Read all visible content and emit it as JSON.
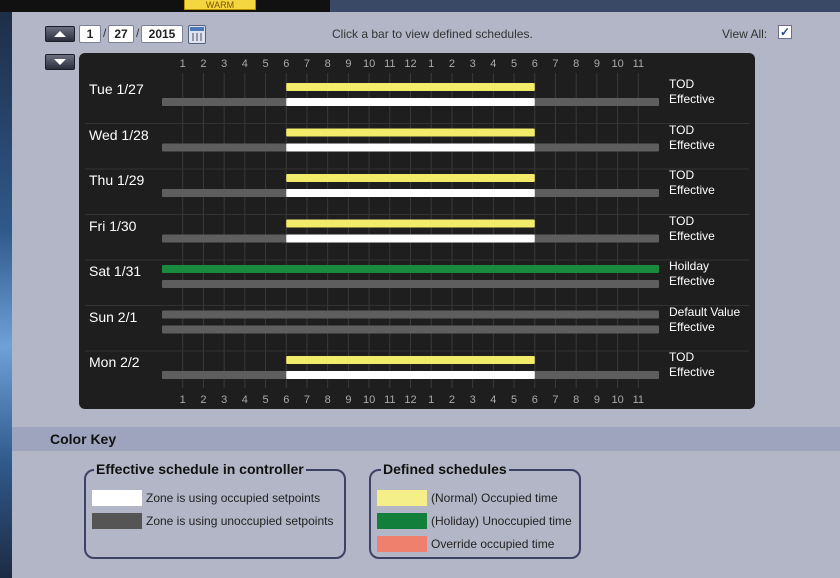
{
  "background": {
    "warm_tab": "WARM"
  },
  "toolbar": {
    "month": "1",
    "day": "27",
    "year": "2015",
    "sep": "/",
    "hint": "Click a bar to view defined schedules.",
    "view_all_label": "View All:",
    "view_all_checked": true,
    "check_mark": "✓"
  },
  "schedule": {
    "hour_labels": [
      "1",
      "2",
      "3",
      "4",
      "5",
      "6",
      "7",
      "8",
      "9",
      "10",
      "11",
      "12",
      "1",
      "2",
      "3",
      "4",
      "5",
      "6",
      "7",
      "8",
      "9",
      "10",
      "11"
    ],
    "days": [
      {
        "label": "Tue 1/27",
        "defined": "TOD",
        "effective": "Effective",
        "defined_type": "normal",
        "occupied": [
          6,
          18
        ]
      },
      {
        "label": "Wed 1/28",
        "defined": "TOD",
        "effective": "Effective",
        "defined_type": "normal",
        "occupied": [
          6,
          18
        ]
      },
      {
        "label": "Thu 1/29",
        "defined": "TOD",
        "effective": "Effective",
        "defined_type": "normal",
        "occupied": [
          6,
          18
        ]
      },
      {
        "label": "Fri 1/30",
        "defined": "TOD",
        "effective": "Effective",
        "defined_type": "normal",
        "occupied": [
          6,
          18
        ]
      },
      {
        "label": "Sat 1/31",
        "defined": "Hoilday",
        "effective": "Effective",
        "defined_type": "holiday",
        "occupied": null
      },
      {
        "label": "Sun 2/1",
        "defined": "Default Value",
        "effective": "Effective",
        "defined_type": "default",
        "occupied": null
      },
      {
        "label": "Mon 2/2",
        "defined": "TOD",
        "effective": "Effective",
        "defined_type": "normal",
        "occupied": [
          6,
          18
        ]
      }
    ]
  },
  "color_key": {
    "title": "Color Key",
    "effective_title": "Effective schedule in controller",
    "defined_title": "Defined schedules",
    "effective_items": [
      {
        "label": "Zone is using occupied setpoints",
        "color": "#ffffff"
      },
      {
        "label": "Zone is using unoccupied setpoints",
        "color": "#555555"
      }
    ],
    "defined_items": [
      {
        "label": "(Normal) Occupied time",
        "color": "#f5ef8a"
      },
      {
        "label": "(Holiday) Unoccupied time",
        "color": "#12803a"
      },
      {
        "label": "Override occupied time",
        "color": "#f0806e"
      }
    ]
  },
  "colors": {
    "normal": "#f3ec6a",
    "holiday": "#1a8a3e",
    "occupied": "#ffffff",
    "unoccupied": "#5e5e5e"
  }
}
